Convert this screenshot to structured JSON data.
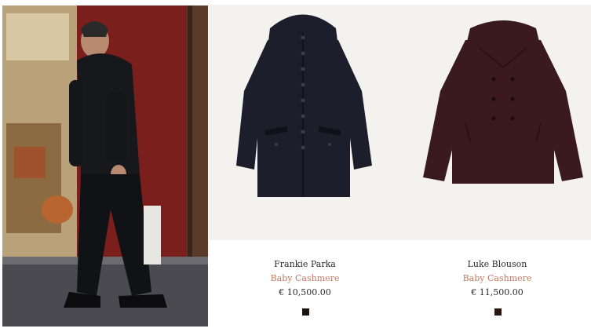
{
  "products": [
    {
      "name": "Frankie Parka",
      "material": "Baby Cashmere",
      "price": "€ 10,500.00",
      "color": "#1c1f2b",
      "swatch_color": "#1a1410"
    },
    {
      "name": "Luke Blouson",
      "material": "Baby Cashmere",
      "price": "€ 11,500.00",
      "color": "#3b1a1f",
      "swatch_color": "#2b1510"
    }
  ],
  "colors": {
    "material_text": "#c07a64",
    "card_background": "#f4f2ef"
  }
}
